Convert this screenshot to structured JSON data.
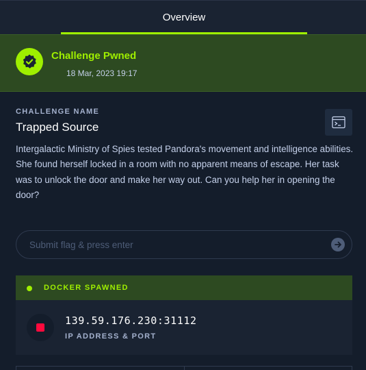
{
  "tabs": [
    {
      "label": "Overview",
      "active": true
    }
  ],
  "status": {
    "title": "Challenge Pwned",
    "date": "18 Mar, 2023 19:17",
    "icon": "check-badge-icon"
  },
  "challenge": {
    "section_label": "CHALLENGE NAME",
    "name": "Trapped Source",
    "description": "Intergalactic Ministry of Spies tested Pandora's movement and intelligence abilities. She found herself locked in a room with no apparent means of escape. Her task was to unlock the door and make her way out. Can you help her in opening the door?",
    "terminal_icon": "terminal-window-icon"
  },
  "flag": {
    "placeholder": "Submit flag & press enter",
    "value": "",
    "submit_icon": "arrow-right-circle-icon"
  },
  "docker": {
    "status": "DOCKER SPAWNED",
    "address": "139.59.176.230:31112",
    "address_label": "IP ADDRESS & PORT",
    "stop_icon": "stop-icon"
  },
  "colors": {
    "background": "#141d2b",
    "panel": "#1a2332",
    "accent": "#9fef00",
    "success_bg": "#2d4a21",
    "danger": "#ff0a3d"
  }
}
